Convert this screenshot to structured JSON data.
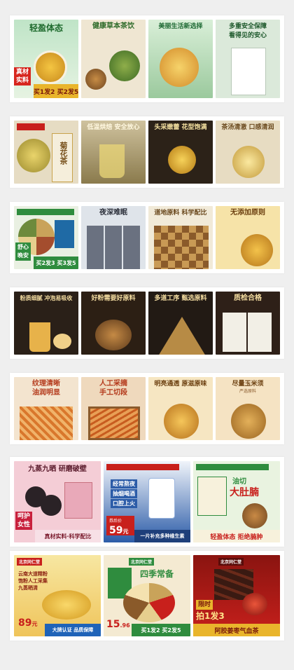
{
  "row1": {
    "t1": {
      "title": "轻盈体态",
      "ribbon_a": "真材",
      "ribbon_b": "实料",
      "bottom": "买1发2 买2发5"
    },
    "t2": {
      "title": "健康草本茶饮"
    },
    "t3": {
      "title": "美丽生活新选择"
    },
    "t4": {
      "title_1": "多重安全保障",
      "title_2": "看得见的安心"
    }
  },
  "row2": {
    "t1": {
      "label": "菊花茶"
    },
    "t2": {
      "title": "低温烘焙 安全放心"
    },
    "t3": {
      "title": "头采嫩蕾 花型饱满"
    },
    "t4": {
      "title": "茶汤清澈 口感清润"
    }
  },
  "row3": {
    "t1": {
      "ribbon_a": "舒心",
      "ribbon_b": "晚安",
      "bottom": "买2发3 买3发5"
    },
    "t2": {
      "title": "夜深难眠"
    },
    "t3": {
      "title": "道地原料 科学配比"
    },
    "t4": {
      "title": "无添加原则"
    }
  },
  "row4": {
    "t1": {
      "title": "粉质细腻 冲泡易吸收"
    },
    "t2": {
      "title": "好粉需要好原料"
    },
    "t3": {
      "title": "多道工序 甄选原料"
    },
    "t4": {
      "title": "质检合格"
    }
  },
  "row5": {
    "t1": {
      "title_1": "纹理清晰",
      "title_2": "油润明显"
    },
    "t2": {
      "title_1": "人工采摘",
      "title_2": "手工切段"
    },
    "t3": {
      "title": "明亮通透 原滋原味"
    },
    "t4": {
      "title": "尽量玉米须",
      "sub": "严选原料"
    }
  },
  "row6": {
    "t1": {
      "title": "九蒸九晒 研磨破壁",
      "ribbon_a": "呵护",
      "ribbon_b": "女性",
      "bottom": "真材实料·科学配比"
    },
    "t2": {
      "bullet_1": "经常熬夜",
      "bullet_2": "抽烟喝酒",
      "bullet_3": "口腔上火",
      "price_label": "券后价",
      "price": "59",
      "yen": "元",
      "bottom": "一片补充多种维生素"
    },
    "t3": {
      "title_1": "油切",
      "title_2": "大肚腩",
      "bottom": "轻盈体态 拒绝腩肿"
    }
  },
  "row7": {
    "t1": {
      "brand": "北京同仁堂",
      "line_1": "云南大道精粉",
      "line_2": "饱粉人工采集",
      "line_3": "九蒸晒清",
      "price": "89",
      "yen": "元",
      "bottom": "大牌认证 品质保障"
    },
    "t2": {
      "brand": "北京同仁堂",
      "title": "四季常备",
      "price": "15",
      "price_dec": ".96",
      "bottom": "买1发2 买2发5"
    },
    "t3": {
      "brand": "北京同仁堂",
      "ribbon": "限时",
      "promo": "拍1发3",
      "bottom": "阿胶姜枣气血茶"
    }
  },
  "colors": {
    "brand_red": "#c8201c",
    "accent_gold": "#e9b52c",
    "green": "#2f8c3e",
    "dark_bg": "#2a1e16"
  }
}
